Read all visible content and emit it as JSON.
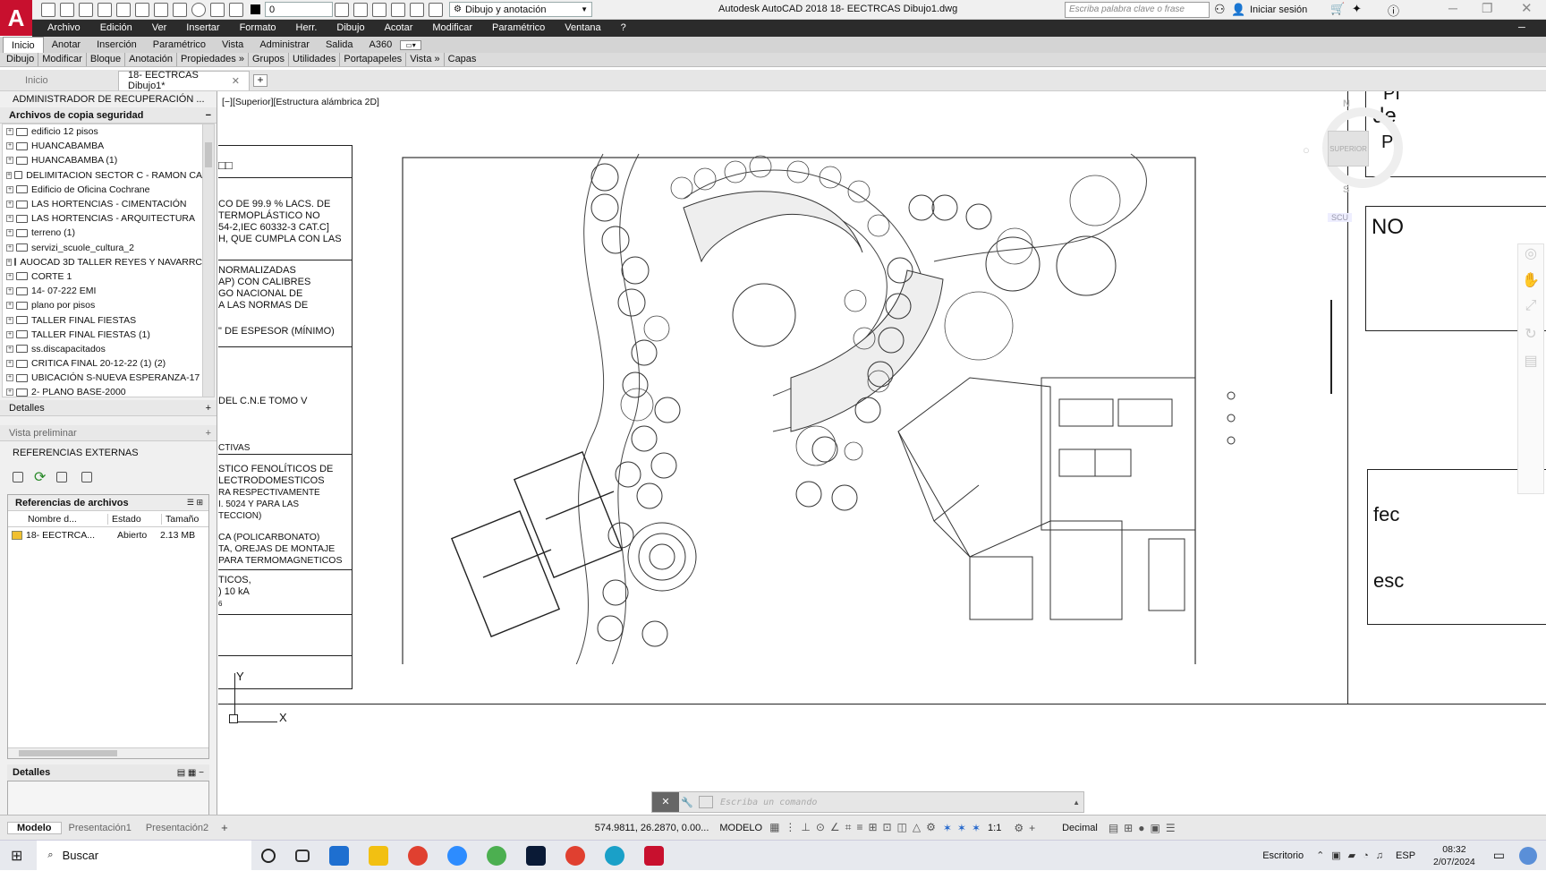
{
  "window": {
    "title": "Autodesk AutoCAD 2018   18- EECTRCAS Dibujo1.dwg",
    "app_logo": "A",
    "layer_value": "0",
    "workspace": "Dibujo y anotación",
    "search_placeholder": "Escriba palabra clave o frase",
    "signin": "Iniciar sesión"
  },
  "menu": [
    "Archivo",
    "Edición",
    "Ver",
    "Insertar",
    "Formato",
    "Herr.",
    "Dibujo",
    "Acotar",
    "Modificar",
    "Paramétrico",
    "Ventana",
    "?"
  ],
  "ribbon_tabs": [
    "Inicio",
    "Anotar",
    "Inserción",
    "Paramétrico",
    "Vista",
    "Administrar",
    "Salida",
    "A360"
  ],
  "ribbon_panels": [
    "Dibujo",
    "Modificar",
    "Bloque",
    "Anotación",
    "Propiedades »",
    "Grupos",
    "Utilidades",
    "Portapapeles",
    "Vista »",
    "Capas"
  ],
  "doc_tabs": [
    "Inicio",
    "18- EECTRCAS Dibujo1*"
  ],
  "viewport_label": "[−][Superior][Estructura alámbrica 2D]",
  "palette": {
    "title": "ADMINISTRADOR DE RECUPERACIÓN ...",
    "backup_header": "Archivos de copia seguridad",
    "backups": [
      "edificio 12 pisos",
      "HUANCABAMBA",
      "HUANCABAMBA (1)",
      "DELIMITACION SECTOR C - RAMON CA",
      "Edificio de Oficina Cochrane",
      "LAS HORTENCIAS - CIMENTACIÓN",
      "LAS HORTENCIAS - ARQUITECTURA",
      "terreno (1)",
      "servizi_scuole_cultura_2",
      "AUOCAD 3D TALLER REYES Y NAVARRC",
      "CORTE 1",
      "14- 07-222 EMI",
      "plano por pisos",
      "TALLER FINAL FIESTAS",
      "TALLER FINAL FIESTAS (1)",
      "ss.discapacitados",
      "CRITICA FINAL 20-12-22  (1) (2)",
      "UBICACIÓN S-NUEVA ESPERANZA-17",
      "2- PLANO BASE-2000"
    ],
    "details": "Detalles",
    "preview": "Vista preliminar",
    "xrefs_title": "REFERENCIAS EXTERNAS",
    "file_refs": "Referencias de archivos",
    "cols": [
      "Nombre d...",
      "Estado",
      "Tamaño"
    ],
    "file_row": {
      "name": "18- EECTRCA...",
      "state": "Abierto",
      "size": "2.13 MB"
    },
    "details2": "Detalles"
  },
  "notes": [
    "CO DE 99.9 % LACS. DE",
    "TERMOPLÁSTICO NO",
    "54-2,IEC 60332-3 CAT.C]",
    "H, QUE CUMPLA CON LAS",
    "NORMALIZADAS",
    "AP) CON CALIBRES",
    "GO NACIONAL DE",
    "A LAS NORMAS DE",
    "\" DE ESPESOR (MÍNIMO)",
    "DEL C.N.E TOMO V",
    "CTIVAS",
    "STICO FENOLÍTICOS DE",
    "LECTRODOMESTICOS",
    "RA RESPECTIVAMENTE",
    "I. 5024 Y PARA LAS",
    "TECCION)",
    "CA (POLICARBONATO)",
    "TA, OREJAS DE MONTAJE",
    "PARA TERMOMAGNETICOS",
    "TICOS,",
    ") 10 kA",
    "6"
  ],
  "right_text": [
    "PI",
    "de",
    "PI",
    "NO",
    "fec",
    "esc"
  ],
  "viewcube": {
    "n": "N",
    "s": "S",
    "top": "SUPERIOR",
    "scu": "SCU"
  },
  "ucs": {
    "x": "X",
    "y": "Y"
  },
  "command_placeholder": "Escriba un comando",
  "layout_tabs": [
    "Modelo",
    "Presentación1",
    "Presentación2"
  ],
  "status": {
    "coords": "574.9811, 26.2870, 0.00...",
    "mode": "MODELO",
    "scale": "1:1",
    "units": "Decimal"
  },
  "taskbar": {
    "search": "Buscar",
    "desktop": "Escritorio",
    "lang": "ESP",
    "time": "08:32",
    "date": "2/07/2024"
  }
}
